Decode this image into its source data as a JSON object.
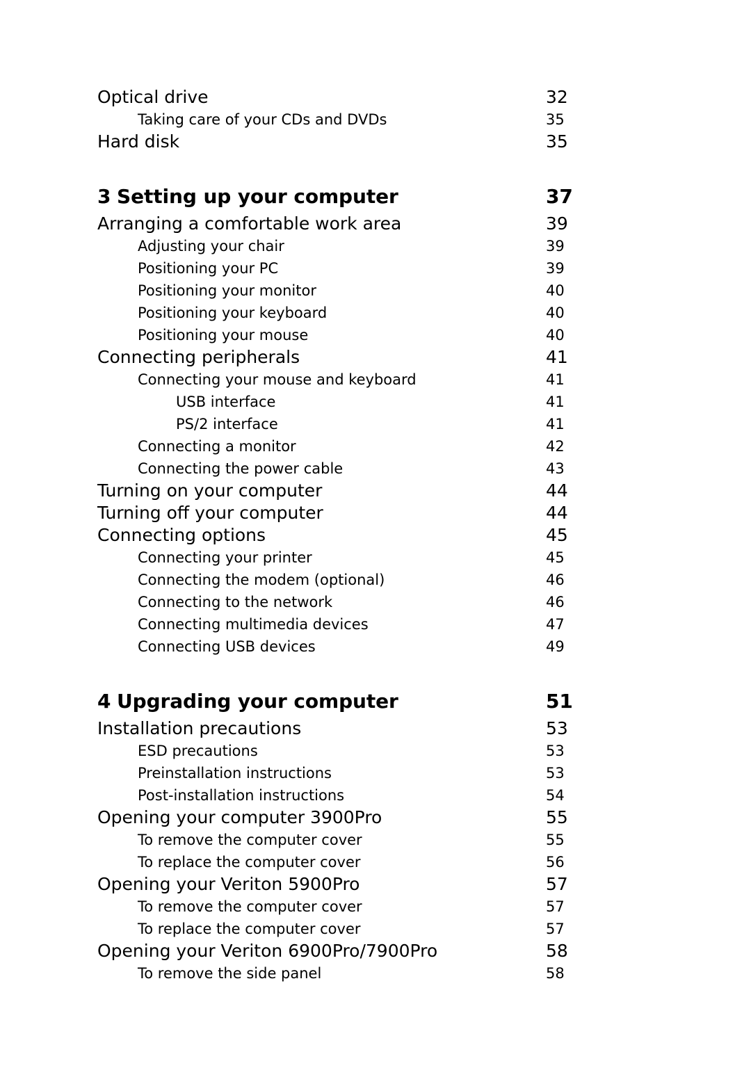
{
  "document": {
    "kind": "table-of-contents",
    "text_color": "#000000",
    "background_color": "#ffffff"
  },
  "toc": {
    "entries": [
      {
        "level": 1,
        "title": "Optical drive",
        "page": "32"
      },
      {
        "level": 2,
        "title": "Taking care of your CDs and DVDs",
        "page": "35"
      },
      {
        "level": 1,
        "title": "Hard disk",
        "page": "35"
      },
      {
        "level": 0,
        "number": "3",
        "title": "Setting up your computer",
        "page": "37"
      },
      {
        "level": 1,
        "title": "Arranging a comfortable work area",
        "page": "39"
      },
      {
        "level": 2,
        "title": "Adjusting your chair",
        "page": "39"
      },
      {
        "level": 2,
        "title": "Positioning your PC",
        "page": "39"
      },
      {
        "level": 2,
        "title": "Positioning your monitor",
        "page": "40"
      },
      {
        "level": 2,
        "title": "Positioning your keyboard",
        "page": "40"
      },
      {
        "level": 2,
        "title": "Positioning your mouse",
        "page": "40"
      },
      {
        "level": 1,
        "title": "Connecting peripherals",
        "page": "41"
      },
      {
        "level": 2,
        "title": "Connecting your mouse and keyboard",
        "page": "41"
      },
      {
        "level": 3,
        "title": "USB interface",
        "page": "41"
      },
      {
        "level": 3,
        "title": "PS/2 interface",
        "page": "41"
      },
      {
        "level": 2,
        "title": "Connecting a monitor",
        "page": "42"
      },
      {
        "level": 2,
        "title": "Connecting the power cable",
        "page": "43"
      },
      {
        "level": 1,
        "title": "Turning on your computer",
        "page": "44"
      },
      {
        "level": 1,
        "title": "Turning off your computer",
        "page": "44"
      },
      {
        "level": 1,
        "title": "Connecting options",
        "page": "45"
      },
      {
        "level": 2,
        "title": "Connecting your printer",
        "page": "45"
      },
      {
        "level": 2,
        "title": "Connecting the modem (optional)",
        "page": "46"
      },
      {
        "level": 2,
        "title": "Connecting to the network",
        "page": "46"
      },
      {
        "level": 2,
        "title": "Connecting multimedia devices",
        "page": "47"
      },
      {
        "level": 2,
        "title": "Connecting USB devices",
        "page": "49"
      },
      {
        "level": 0,
        "number": "4",
        "title": "Upgrading your computer",
        "page": "51"
      },
      {
        "level": 1,
        "title": "Installation precautions",
        "page": "53"
      },
      {
        "level": 2,
        "title": "ESD precautions",
        "page": "53"
      },
      {
        "level": 2,
        "title": "Preinstallation instructions",
        "page": "53"
      },
      {
        "level": 2,
        "title": "Post-installation instructions",
        "page": "54"
      },
      {
        "level": 1,
        "title": "Opening your computer 3900Pro",
        "page": "55"
      },
      {
        "level": 2,
        "title": "To remove the computer cover",
        "page": "55"
      },
      {
        "level": 2,
        "title": "To replace the computer cover",
        "page": "56"
      },
      {
        "level": 1,
        "title": "Opening your Veriton 5900Pro",
        "page": "57"
      },
      {
        "level": 2,
        "title": "To remove the computer cover",
        "page": "57"
      },
      {
        "level": 2,
        "title": "To replace the computer cover",
        "page": "57"
      },
      {
        "level": 1,
        "title": "Opening your Veriton 6900Pro/7900Pro",
        "page": "58"
      },
      {
        "level": 2,
        "title": "To remove the side panel",
        "page": "58"
      }
    ]
  }
}
